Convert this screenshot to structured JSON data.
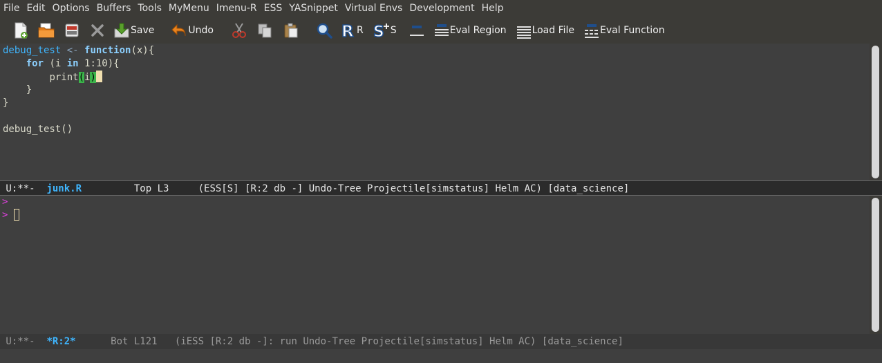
{
  "menubar": {
    "items": [
      "File",
      "Edit",
      "Options",
      "Buffers",
      "Tools",
      "MyMenu",
      "Imenu-R",
      "ESS",
      "YASnippet",
      "Virtual Envs",
      "Development",
      "Help"
    ]
  },
  "toolbar": {
    "buttons": [
      {
        "icon": "new-file-icon",
        "label": ""
      },
      {
        "icon": "open-folder-icon",
        "label": ""
      },
      {
        "icon": "dired-icon",
        "label": ""
      },
      {
        "icon": "close-icon",
        "label": ""
      },
      {
        "icon": "save-icon",
        "label": "Save"
      },
      {
        "icon": "undo-icon",
        "label": "Undo"
      },
      {
        "icon": "cut-icon",
        "label": ""
      },
      {
        "icon": "copy-icon",
        "label": ""
      },
      {
        "icon": "paste-icon",
        "label": ""
      },
      {
        "icon": "search-icon",
        "label": ""
      },
      {
        "icon": "r-icon",
        "label": "R"
      },
      {
        "icon": "s-plus-icon",
        "label": "S"
      },
      {
        "icon": "eval-line-icon",
        "label": ""
      },
      {
        "icon": "eval-region-icon",
        "label": "Eval Region"
      },
      {
        "icon": "load-file-icon",
        "label": "Load File"
      },
      {
        "icon": "eval-function-icon",
        "label": "Eval Function"
      }
    ]
  },
  "code": {
    "l1_name": "debug_test",
    "l1_assign": " <- ",
    "l1_kw": "function",
    "l1_rest": "(x){",
    "l2_indent": "    ",
    "l2_kw_for": "for",
    "l2_mid": " (i ",
    "l2_kw_in": "in",
    "l2_rest": " 1:10){",
    "l3_indent": "        ",
    "l3_call": "print",
    "l3_paren_open": "(",
    "l3_arg": "i",
    "l3_paren_close": ")",
    "l4": "    }",
    "l5": "}",
    "l6": "",
    "l7": "debug_test()"
  },
  "modeline_top": {
    "status": " U:**-  ",
    "buffer": "junk.R",
    "rest": "         Top L3     (ESS[S] [R:2 db -] Undo-Tree Projectile[simstatus] Helm AC) [data_science]"
  },
  "repl": {
    "prompt1": ">",
    "prompt2": ">"
  },
  "modeline_bottom": {
    "status": " U:**-  ",
    "buffer": "*R:2*",
    "rest": "      Bot L121   (iESS [R:2 db -]: run Undo-Tree Projectile[simstatus] Helm AC) [data_science]"
  }
}
